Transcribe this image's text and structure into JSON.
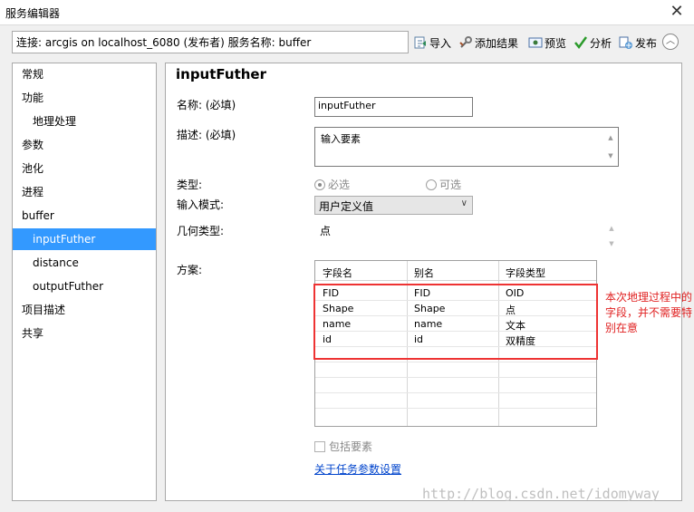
{
  "window": {
    "title": "服务编辑器",
    "close_glyph": "✕"
  },
  "connection": {
    "text": "连接: arcgis on localhost_6080 (发布者)    服务名称: buffer"
  },
  "toolbar": {
    "import": "导入",
    "add_result": "添加结果",
    "preview": "预览",
    "analyze": "分析",
    "publish": "发布",
    "collapse_glyph": "︿"
  },
  "sidebar": {
    "items": [
      {
        "label": "常规"
      },
      {
        "label": "功能"
      },
      {
        "label": "地理处理"
      },
      {
        "label": "参数"
      },
      {
        "label": "池化"
      },
      {
        "label": "进程"
      },
      {
        "label": "buffer"
      },
      {
        "label": "inputFuther"
      },
      {
        "label": "distance"
      },
      {
        "label": "outputFuther"
      },
      {
        "label": "项目描述"
      },
      {
        "label": "共享"
      }
    ],
    "selected_index": 7
  },
  "form": {
    "heading": "inputFuther",
    "name_label": "名称: (必填)",
    "name_value": "inputFuther",
    "desc_label": "描述: (必填)",
    "desc_value": "输入要素",
    "type_label": "类型:",
    "type_required": "必选",
    "type_optional": "可选",
    "input_mode_label": "输入模式:",
    "input_mode_value": "用户定义值",
    "geometry_label": "几何类型:",
    "geometry_value": "点",
    "schema_label": "方案:",
    "include_features": "包括要素",
    "task_link": "关于任务参数设置"
  },
  "schema_table": {
    "headers": [
      "字段名",
      "别名",
      "字段类型"
    ],
    "rows": [
      [
        "FID",
        "FID",
        "OID"
      ],
      [
        "Shape",
        "Shape",
        "点"
      ],
      [
        "name",
        "name",
        "文本"
      ],
      [
        "id",
        "id",
        "双精度"
      ]
    ]
  },
  "annotation": {
    "text": "本次地理过程中的字段，并不需要特别在意",
    "color": "#e02020"
  },
  "watermark": "http://blog.csdn.net/idomyway"
}
